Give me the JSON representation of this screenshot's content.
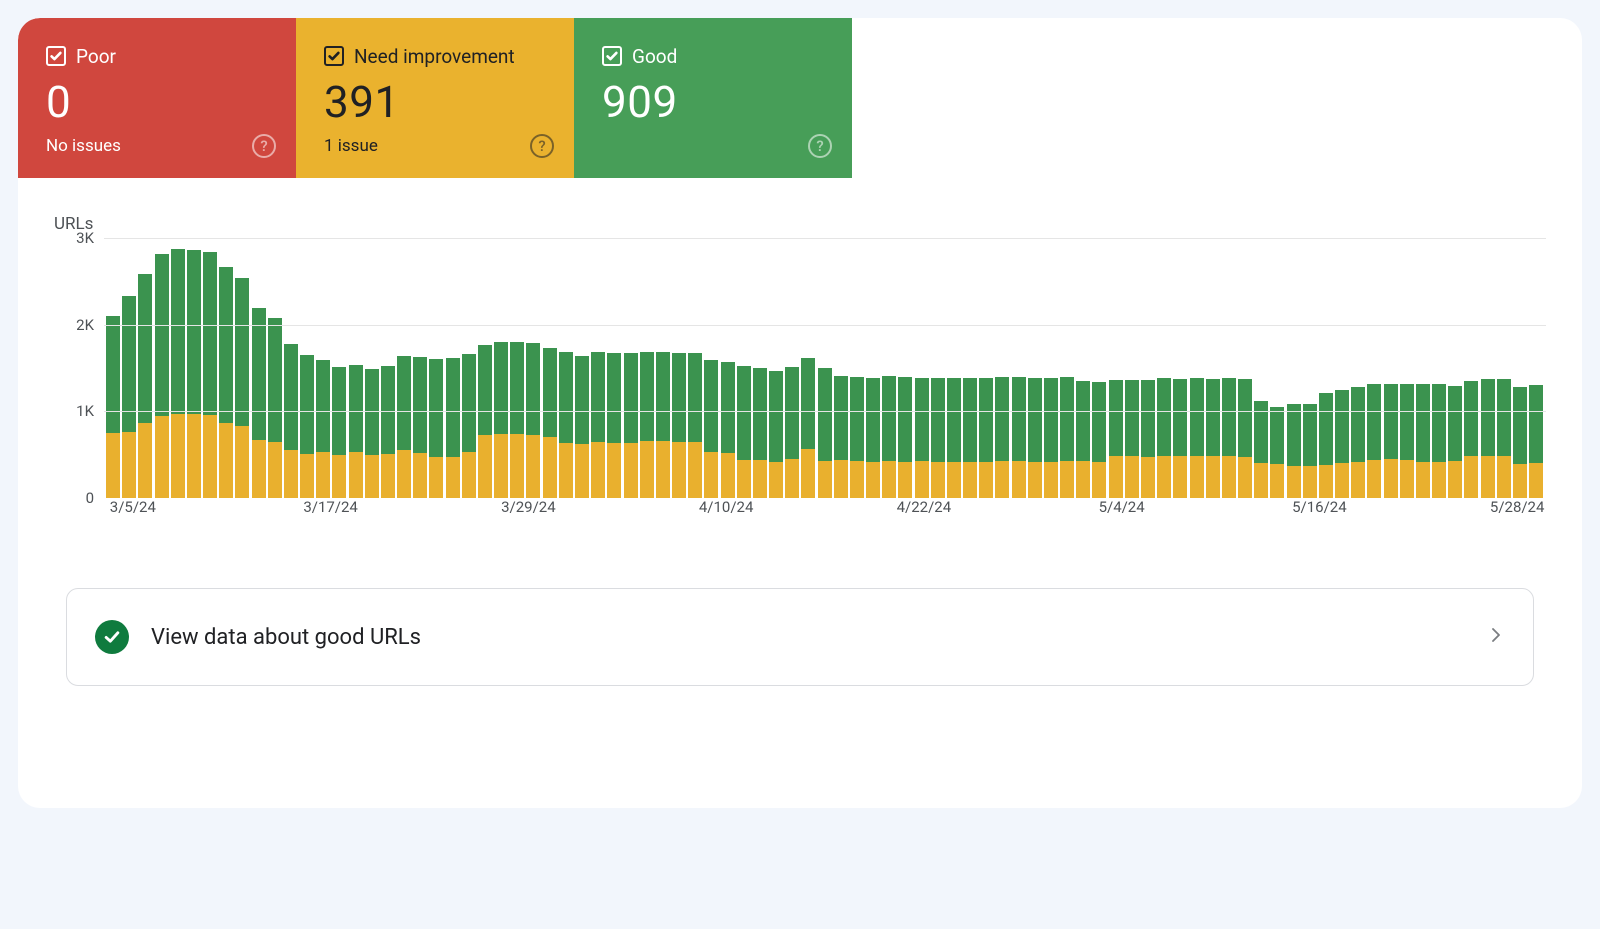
{
  "tiles": {
    "poor": {
      "label": "Poor",
      "value": "0",
      "sub": "No issues"
    },
    "need": {
      "label": "Need improvement",
      "value": "391",
      "sub": "1 issue"
    },
    "good": {
      "label": "Good",
      "value": "909",
      "sub": ""
    }
  },
  "info_row": {
    "text": "View data about good URLs"
  },
  "chart_data": {
    "type": "bar",
    "title": "URLs",
    "ylabel": "",
    "ylim": [
      0,
      3000
    ],
    "yticks": [
      0,
      1000,
      2000,
      3000
    ],
    "ytick_labels": [
      "0",
      "1K",
      "2K",
      "3K"
    ],
    "xlabels": [
      "3/5/24",
      "3/17/24",
      "3/29/24",
      "4/10/24",
      "4/22/24",
      "5/4/24",
      "5/16/24",
      "5/28/24"
    ],
    "categories": [
      "3/5/24",
      "3/6/24",
      "3/7/24",
      "3/8/24",
      "3/9/24",
      "3/10/24",
      "3/11/24",
      "3/12/24",
      "3/13/24",
      "3/14/24",
      "3/15/24",
      "3/16/24",
      "3/17/24",
      "3/18/24",
      "3/19/24",
      "3/20/24",
      "3/21/24",
      "3/22/24",
      "3/23/24",
      "3/24/24",
      "3/25/24",
      "3/26/24",
      "3/27/24",
      "3/28/24",
      "3/29/24",
      "3/30/24",
      "3/31/24",
      "4/1/24",
      "4/2/24",
      "4/3/24",
      "4/4/24",
      "4/5/24",
      "4/6/24",
      "4/7/24",
      "4/8/24",
      "4/9/24",
      "4/10/24",
      "4/11/24",
      "4/12/24",
      "4/13/24",
      "4/14/24",
      "4/15/24",
      "4/16/24",
      "4/17/24",
      "4/18/24",
      "4/19/24",
      "4/20/24",
      "4/21/24",
      "4/22/24",
      "4/23/24",
      "4/24/24",
      "4/25/24",
      "4/26/24",
      "4/27/24",
      "4/28/24",
      "4/29/24",
      "4/30/24",
      "5/1/24",
      "5/2/24",
      "5/3/24",
      "5/4/24",
      "5/5/24",
      "5/6/24",
      "5/7/24",
      "5/8/24",
      "5/9/24",
      "5/10/24",
      "5/11/24",
      "5/12/24",
      "5/13/24",
      "5/14/24",
      "5/15/24",
      "5/16/24",
      "5/17/24",
      "5/18/24",
      "5/19/24",
      "5/20/24",
      "5/21/24",
      "5/22/24",
      "5/23/24",
      "5/24/24",
      "5/25/24",
      "5/26/24",
      "5/27/24",
      "5/28/24",
      "5/29/24",
      "5/30/24",
      "5/31/24",
      "6/1/24"
    ],
    "series": [
      {
        "name": "Need improvement",
        "color": "#E9B02E",
        "values": [
          750,
          760,
          860,
          950,
          970,
          970,
          960,
          870,
          830,
          670,
          650,
          550,
          510,
          530,
          500,
          530,
          500,
          510,
          550,
          520,
          470,
          470,
          530,
          730,
          740,
          740,
          730,
          700,
          640,
          620,
          650,
          630,
          640,
          660,
          660,
          650,
          650,
          530,
          520,
          440,
          440,
          420,
          450,
          560,
          430,
          440,
          430,
          420,
          430,
          420,
          430,
          420,
          410,
          420,
          420,
          430,
          430,
          420,
          420,
          430,
          430,
          420,
          480,
          490,
          470,
          490,
          480,
          490,
          480,
          480,
          470,
          400,
          390,
          370,
          370,
          380,
          400,
          420,
          440,
          450,
          440,
          420,
          420,
          430,
          490,
          490,
          480,
          390,
          400
        ]
      },
      {
        "name": "Good",
        "color": "#3B934F",
        "values": [
          1350,
          1570,
          1720,
          1870,
          1900,
          1890,
          1880,
          1800,
          1710,
          1520,
          1430,
          1230,
          1140,
          1060,
          1010,
          1000,
          990,
          1010,
          1090,
          1110,
          1130,
          1150,
          1130,
          1040,
          1060,
          1060,
          1060,
          1030,
          1040,
          1020,
          1040,
          1040,
          1030,
          1030,
          1020,
          1020,
          1020,
          1060,
          1050,
          1080,
          1060,
          1050,
          1060,
          1050,
          1070,
          970,
          970,
          960,
          980,
          980,
          960,
          960,
          970,
          970,
          970,
          970,
          970,
          970,
          970,
          970,
          920,
          920,
          880,
          870,
          890,
          890,
          890,
          890,
          890,
          900,
          900,
          720,
          660,
          710,
          720,
          830,
          850,
          860,
          870,
          870,
          880,
          900,
          900,
          860,
          860,
          880,
          890,
          890,
          900
        ]
      }
    ]
  },
  "colors": {
    "poor": "#D0473E",
    "need": "#EAB22E",
    "good": "#479E58"
  }
}
